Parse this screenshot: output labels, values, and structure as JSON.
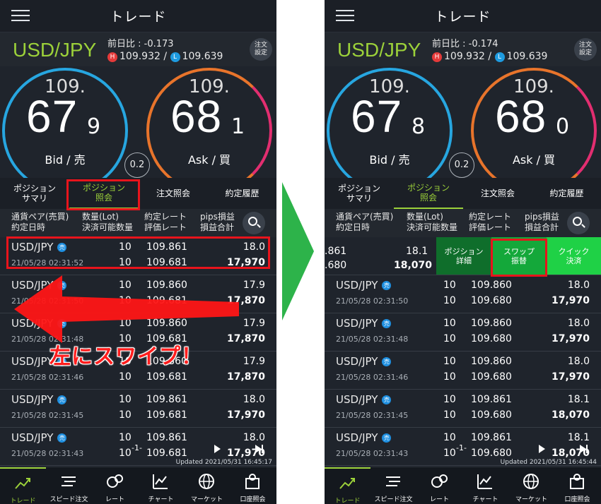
{
  "header": {
    "title": "トレード"
  },
  "left": {
    "pair": "USD/JPY",
    "prev_diff": "前日比 : -0.173",
    "high": "109.932",
    "low": "109.639",
    "hl_sep": "/",
    "order_settings_l1": "注文",
    "order_settings_l2": "設定",
    "bid": {
      "int": "109.",
      "big": "67",
      "small": "9",
      "label": "Bid / 売"
    },
    "ask": {
      "int": "109.",
      "big": "68",
      "small": "1",
      "label": "Ask / 買"
    },
    "spread": "0.2",
    "updated": "Updated  2021/05/31 16:45:17",
    "rows": [
      {
        "pair": "USD/JPY",
        "side": "売",
        "date": "21/05/28 02:31:52",
        "q1": "10",
        "q2": "10",
        "p1": "109.861",
        "p2": "109.681",
        "s1": "18.0",
        "s2": "17,970"
      },
      {
        "pair": "USD/JPY",
        "side": "売",
        "date": "21/05/28 02:31:50",
        "q1": "10",
        "q2": "10",
        "p1": "109.860",
        "p2": "109.681",
        "s1": "17.9",
        "s2": "17,870"
      },
      {
        "pair": "USD/JPY",
        "side": "売",
        "date": "21/05/28 02:31:48",
        "q1": "10",
        "q2": "10",
        "p1": "109.860",
        "p2": "109.681",
        "s1": "17.9",
        "s2": "17,870"
      },
      {
        "pair": "USD/JPY",
        "side": "売",
        "date": "21/05/28 02:31:46",
        "q1": "10",
        "q2": "10",
        "p1": "109.860",
        "p2": "109.681",
        "s1": "17.9",
        "s2": "17,870"
      },
      {
        "pair": "USD/JPY",
        "side": "売",
        "date": "21/05/28 02:31:45",
        "q1": "10",
        "q2": "10",
        "p1": "109.861",
        "p2": "109.681",
        "s1": "18.0",
        "s2": "17,970"
      },
      {
        "pair": "USD/JPY",
        "side": "売",
        "date": "21/05/28 02:31:43",
        "q1": "10",
        "q2": "10",
        "p1": "109.861",
        "p2": "109.681",
        "s1": "18.0",
        "s2": "17,970"
      }
    ],
    "annotation": "左にスワイプ！"
  },
  "right": {
    "pair": "USD/JPY",
    "prev_diff": "前日比 : -0.174",
    "high": "109.932",
    "low": "109.639",
    "hl_sep": "/",
    "order_settings_l1": "注文",
    "order_settings_l2": "設定",
    "bid": {
      "int": "109.",
      "big": "67",
      "small": "8",
      "label": "Bid / 売"
    },
    "ask": {
      "int": "109.",
      "big": "68",
      "small": "0",
      "label": "Ask / 買"
    },
    "spread": "0.2",
    "updated": "Updated  2021/05/31 16:45:44",
    "slid_row": {
      "p1": ".861",
      "p2": ".680",
      "s1": "18.1",
      "s2": "18,070"
    },
    "actions": [
      {
        "l1": "ポジション",
        "l2": "詳細"
      },
      {
        "l1": "スワップ",
        "l2": "振替"
      },
      {
        "l1": "クイック",
        "l2": "決済"
      }
    ],
    "rows": [
      {
        "pair": "USD/JPY",
        "side": "売",
        "date": "21/05/28 02:31:50",
        "q1": "10",
        "q2": "10",
        "p1": "109.860",
        "p2": "109.680",
        "s1": "18.0",
        "s2": "17,970"
      },
      {
        "pair": "USD/JPY",
        "side": "売",
        "date": "21/05/28 02:31:48",
        "q1": "10",
        "q2": "10",
        "p1": "109.860",
        "p2": "109.680",
        "s1": "18.0",
        "s2": "17,970"
      },
      {
        "pair": "USD/JPY",
        "side": "売",
        "date": "21/05/28 02:31:46",
        "q1": "10",
        "q2": "10",
        "p1": "109.860",
        "p2": "109.680",
        "s1": "18.0",
        "s2": "17,970"
      },
      {
        "pair": "USD/JPY",
        "side": "売",
        "date": "21/05/28 02:31:45",
        "q1": "10",
        "q2": "10",
        "p1": "109.861",
        "p2": "109.680",
        "s1": "18.1",
        "s2": "18,070"
      },
      {
        "pair": "USD/JPY",
        "side": "売",
        "date": "21/05/28 02:31:43",
        "q1": "10",
        "q2": "10",
        "p1": "109.861",
        "p2": "109.680",
        "s1": "18.1",
        "s2": "18,070"
      }
    ]
  },
  "tabs": [
    {
      "l1": "ポジション",
      "l2": "サマリ"
    },
    {
      "l1": "ポジション",
      "l2": "照会"
    },
    {
      "l1": "注文照会",
      "l2": ""
    },
    {
      "l1": "約定履歴",
      "l2": ""
    }
  ],
  "columns": {
    "c1a": "通貨ペア(売買)",
    "c1b": "約定日時",
    "c2a": "数量(Lot)",
    "c2b": "決済可能数量",
    "c3a": "約定レート",
    "c3b": "評価レート",
    "c4a": "pips損益",
    "c4b": "損益合計"
  },
  "pager": {
    "page": "-1-"
  },
  "nav": [
    {
      "label": "トレード",
      "icon": "trade-chart-icon"
    },
    {
      "label": "スピード注文",
      "icon": "speed-order-icon"
    },
    {
      "label": "レート",
      "icon": "rate-icon"
    },
    {
      "label": "チャート",
      "icon": "chart-icon"
    },
    {
      "label": "マーケット",
      "icon": "globe-icon"
    },
    {
      "label": "口座照会",
      "icon": "account-icon"
    }
  ],
  "colors": {
    "accent": "#9cd13a",
    "bid": "#27a6e0",
    "ask": "#e8742b",
    "highlight": "#e8141c",
    "action_green": "#14a83a"
  }
}
